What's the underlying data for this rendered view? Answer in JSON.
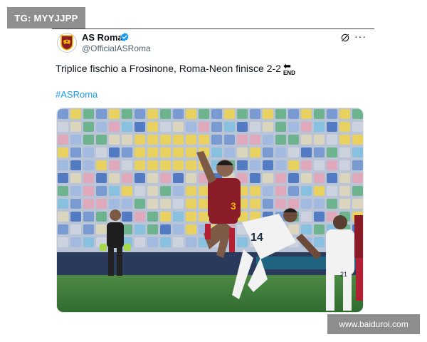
{
  "watermark_top": "TG: MYYJJPP",
  "watermark_bottom": "www.baiduroi.com",
  "tweet": {
    "author_name": "AS Roma",
    "author_handle": "@OfficialASRoma",
    "verified": true,
    "text": "Triplice fischio a Frosinone, Roma-Neon finisce 2-2",
    "end_emoji": {
      "arrow": "⬅",
      "label": "END"
    },
    "hashtag": "#ASRoma",
    "icons": [
      "verified-badge-icon",
      "grok-icon",
      "more-options-icon",
      "as-roma-crest-icon"
    ],
    "photo": {
      "player_numbers": [
        "3",
        "14",
        "21"
      ]
    }
  },
  "colors": {
    "link": "#1d9bf0",
    "verified": "#1d9bf0",
    "roma_shirt": "#8a1c28",
    "neon_shirt": "#f2f2f2",
    "pitch": "#3f7a3a"
  }
}
